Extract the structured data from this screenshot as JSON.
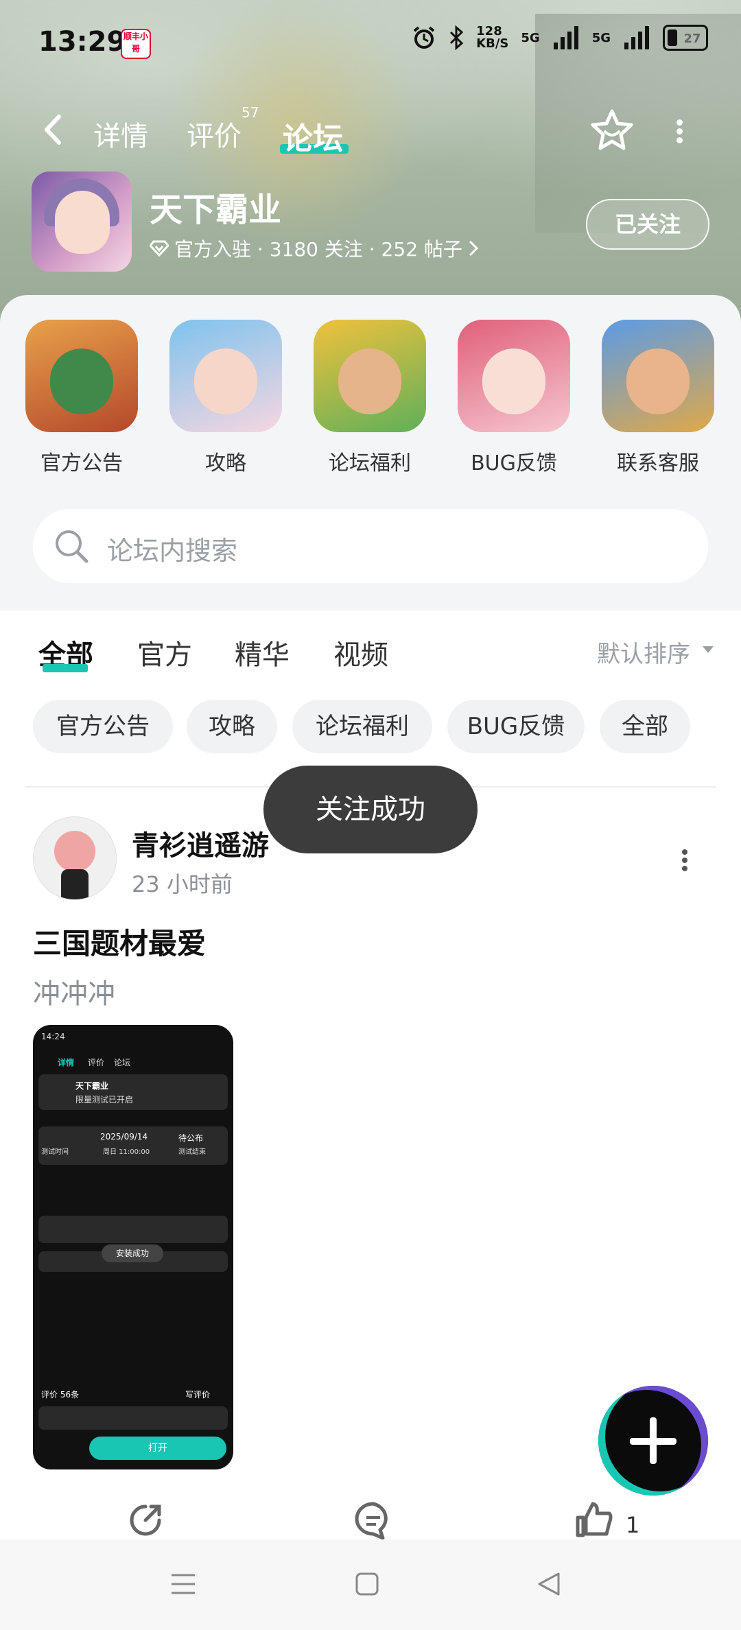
{
  "status_bar": {
    "time": "13:29",
    "app_badge": "顺丰小哥",
    "net_speed": "128\nKB/S",
    "signal_1": "5G",
    "signal_2": "5G",
    "battery": "27"
  },
  "top_nav": {
    "tabs": [
      {
        "label": "详情",
        "active": false
      },
      {
        "label": "评价",
        "active": false,
        "count": "57"
      },
      {
        "label": "论坛",
        "active": true
      }
    ]
  },
  "game": {
    "title": "天下霸业",
    "meta": "官方入驻 · 3180 关注 · 252 帖子",
    "follow_label": "已关注"
  },
  "categories": [
    {
      "label": "官方公告"
    },
    {
      "label": "攻略"
    },
    {
      "label": "论坛福利"
    },
    {
      "label": "BUG反馈"
    },
    {
      "label": "联系客服"
    }
  ],
  "search": {
    "placeholder": "论坛内搜索"
  },
  "feed_tabs": [
    {
      "label": "全部",
      "active": true
    },
    {
      "label": "官方",
      "active": false
    },
    {
      "label": "精华",
      "active": false
    },
    {
      "label": "视频",
      "active": false
    }
  ],
  "sort_label": "默认排序",
  "chips": [
    "官方公告",
    "攻略",
    "论坛福利",
    "BUG反馈",
    "全部"
  ],
  "toast": "关注成功",
  "post": {
    "username": "青衫逍遥游",
    "time": "23 小时前",
    "title": "三国题材最爱",
    "content": "冲冲冲",
    "screenshot": {
      "time": "14:24",
      "tab1": "详情",
      "tab2": "评价",
      "tab3": "论坛",
      "game": "天下霸业",
      "status": "限量测试已开启",
      "date": "2025/09/14",
      "date_sub": "周日 11:00:00",
      "pending": "待公布",
      "test_time": "测试时间",
      "test_end": "测试结束",
      "toast": "安装成功",
      "reviews": "评价",
      "reviews_count": "56条",
      "write_review": "写评价",
      "open": "打开"
    },
    "like_count": "1"
  },
  "colors": {
    "accent": "#19c6b3",
    "toast_bg": "#3c3c3c"
  }
}
